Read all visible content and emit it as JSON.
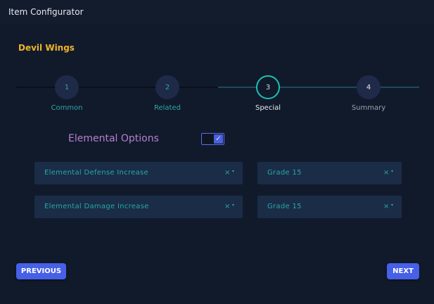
{
  "window": {
    "title": "Item Configurator"
  },
  "item": {
    "name": "Devil Wings"
  },
  "steps": [
    {
      "number": "1",
      "label": "Common",
      "state": "complete"
    },
    {
      "number": "2",
      "label": "Related",
      "state": "complete"
    },
    {
      "number": "3",
      "label": "Special",
      "state": "active"
    },
    {
      "number": "4",
      "label": "Summary",
      "state": "pending"
    }
  ],
  "elemental": {
    "label": "Elemental Options",
    "enabled": true,
    "rows": [
      {
        "option": "Elemental Defense Increase",
        "grade": "Grade 15"
      },
      {
        "option": "Elemental Damage Increase",
        "grade": "Grade 15"
      }
    ]
  },
  "icons": {
    "clear": "×",
    "caret": "▾",
    "check": "✓"
  },
  "buttons": {
    "previous": "PREVIOUS",
    "next": "NEXT"
  },
  "colors": {
    "accent": "#4760e8",
    "teal": "#25a8a8",
    "title_gold": "#f0b429",
    "purple": "#b87fd0"
  }
}
